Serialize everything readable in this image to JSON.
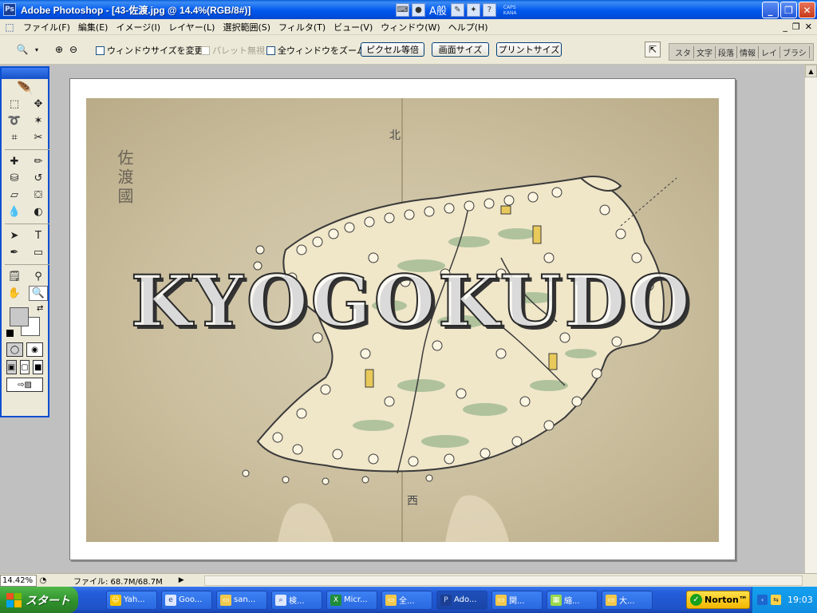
{
  "window": {
    "title": "Adobe Photoshop - [43-佐渡.jpg @ 14.4%(RGB/8#)]",
    "ime_text": "A般",
    "caps_label": "CAPS",
    "kana_label": "KANA",
    "minimize_label": "_",
    "restore_label": "❐",
    "close_label": "✕"
  },
  "menu": {
    "items": [
      "ファイル(F)",
      "編集(E)",
      "イメージ(I)",
      "レイヤー(L)",
      "選択範囲(S)",
      "フィルタ(T)",
      "ビュー(V)",
      "ウィンドウ(W)",
      "ヘルプ(H)"
    ],
    "doc_minimize": "_",
    "doc_restore": "❐",
    "doc_close": "✕"
  },
  "options": {
    "resize_windows": "ウィンドウサイズを変更",
    "ignore_palettes": "パレット無視",
    "zoom_all": "全ウィンドウをズーム",
    "actual_pixels": "ピクセル等倍",
    "fit_screen": "画面サイズ",
    "print_size": "プリントサイズ",
    "palette_tabs": [
      "スタ",
      "文字",
      "段落",
      "情報",
      "レイ",
      "ブラシ"
    ]
  },
  "document": {
    "province_label": "佐渡國",
    "north_label": "北",
    "south_label": "西",
    "watermark": "KYOGOKUDO"
  },
  "status": {
    "zoom": "14.42%",
    "file_info": "ファイル: 68.7M/68.7M"
  },
  "taskbar": {
    "start_label": "スタート",
    "tasks": [
      {
        "label": "Yah...",
        "color": "#f7c600"
      },
      {
        "label": "Goo...",
        "color": "#dfe8ff"
      },
      {
        "label": "san...",
        "color": "#f2c94c"
      },
      {
        "label": "検...",
        "color": "#dfe8ff"
      },
      {
        "label": "Micr...",
        "color": "#1e8d3a"
      },
      {
        "label": "全...",
        "color": "#f2c94c"
      },
      {
        "label": "Ado...",
        "color": "#1c3f94"
      },
      {
        "label": "関...",
        "color": "#f2c94c"
      },
      {
        "label": "縮...",
        "color": "#9ad94a"
      },
      {
        "label": "大...",
        "color": "#f2c94c"
      }
    ],
    "norton_label": "Norton™",
    "clock": "19:03"
  },
  "colors": {
    "title_blue": "#0058ee",
    "taskbar_blue": "#245edb",
    "start_green": "#2f8f2b",
    "map_paper": "#cbbf9f",
    "island_fill": "#f0e6c8"
  }
}
